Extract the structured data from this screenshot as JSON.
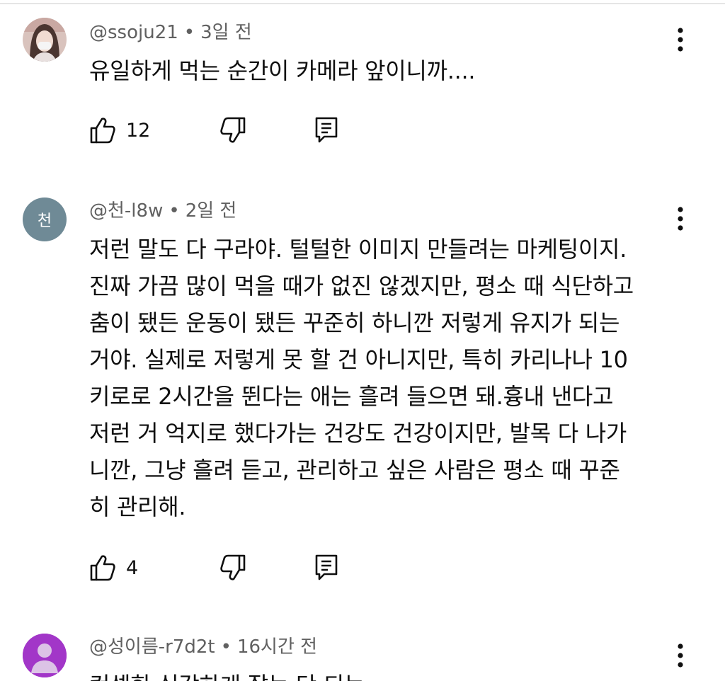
{
  "comments": [
    {
      "handle": "@ssoju21",
      "separator": "•",
      "time": "3일 전",
      "text": "유일하게 먹는 순간이 카메라 앞이니까....",
      "likes": "12"
    },
    {
      "avatar_letter": "천",
      "handle": "@천-l8w",
      "separator": "•",
      "time": "2일 전",
      "text": "저런 말도 다 구라야. 털털한 이미지 만들려는 마케팅이지.\n진짜 가끔 많이 먹을 때가 없진 않겠지만, 평소 때 식단하고\n춤이 됐든 운동이 됐든 꾸준히 하니깐 저렇게 유지가 되는\n거야. 실제로 저렇게 못 할 건 아니지만, 특히 카리나나 10\n키로로 2시간을 뛴다는 애는 흘려 들으면 돼.흉내 낸다고\n저런 거 억지로 했다가는 건강도 건강이지만, 발목 다 나가\n니깐, 그냥 흘려 듣고, 관리하고 싶은 사람은 평소 때 꾸준\n히 관리해.",
      "likes": "4"
    },
    {
      "handle": "@성이름-r7d2t",
      "separator": "•",
      "time": "16시간 전",
      "text": "컨셉한 심각하게 잘는 단 되는"
    }
  ]
}
